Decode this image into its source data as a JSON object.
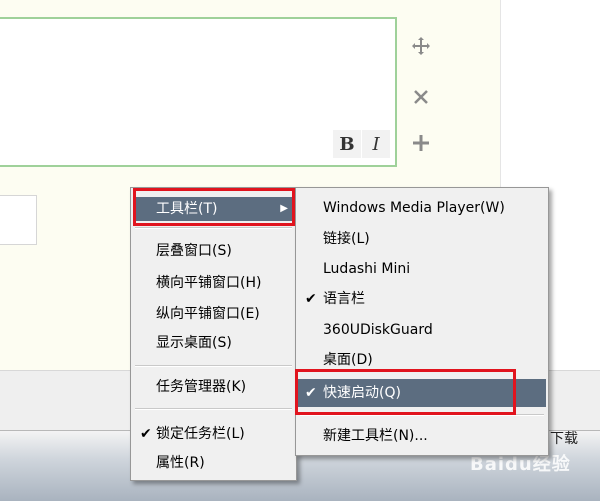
{
  "editor": {
    "bold_label": "B",
    "italic_label": "I"
  },
  "side_icons": [
    "move-icon",
    "close-icon",
    "plus-icon"
  ],
  "context_menu": {
    "toolbar_label": "工具栏(T)",
    "cascade": "层叠窗口(S)",
    "tile_horizontal": "横向平铺窗口(H)",
    "tile_vertical": "纵向平铺窗口(E)",
    "show_desktop": "显示桌面(S)",
    "task_manager": "任务管理器(K)",
    "lock_taskbar": "锁定任务栏(L)",
    "properties": "属性(R)"
  },
  "toolbar_submenu": {
    "wmp": "Windows Media Player(W)",
    "links": "链接(L)",
    "ludashi": "Ludashi Mini",
    "language_bar": "语言栏",
    "udisk": "360UDiskGuard",
    "desktop": "桌面(D)",
    "quick_launch": "快速启动(Q)",
    "new_toolbar": "新建工具栏(N)..."
  },
  "check_mark": "✔",
  "submenu_arrow": "▶",
  "taskbar": {
    "download_label": "下载",
    "watermark": "Baidu经验"
  },
  "colors": {
    "highlight": "#5c6d80",
    "annotation_red": "#e1141e",
    "editor_border": "#9fd19a"
  }
}
